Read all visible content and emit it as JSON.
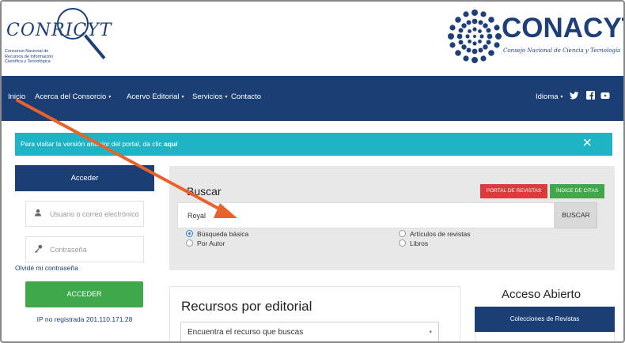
{
  "header": {
    "left_logo_word": "CONRICYT",
    "left_logo_sub": "Consorcio Nacional de Recursos de Información Científica y Tecnológica",
    "right_logo_brand": "CONACYT",
    "right_logo_tagline": "Consejo Nacional de Ciencia y Tecnología"
  },
  "nav": {
    "items": [
      {
        "label": "Inicio"
      },
      {
        "label": "Acerca del Consorcio",
        "caret": "▾"
      },
      {
        "label": "Acervo Editorial",
        "caret": "▾"
      },
      {
        "label": "Servicios",
        "caret": "▾"
      },
      {
        "label": "Contacto"
      }
    ],
    "idioma": "Idioma",
    "idioma_caret": "▾",
    "social": [
      "twitter-icon",
      "facebook-icon",
      "youtube-icon"
    ],
    "color": "#1b3f75"
  },
  "banner": {
    "text": "Para visitar la versión anterior del portal, da clic ",
    "link": "aquí",
    "close": "×",
    "color": "#1fb3c6"
  },
  "login": {
    "title": "Acceder",
    "user_placeholder": "Usuario o correo electrónico",
    "password_placeholder": "Contraseña",
    "forgot": "Olvidé mi contraseña",
    "button": "ACCEDER",
    "ip_text": "IP no registrada 201.110.171.28"
  },
  "search": {
    "title": "Buscar",
    "portal_button": "PORTAL DE REVISTAS",
    "citas_button": "ÍNDICE DE CITAS",
    "value": "Royal",
    "submit": "BUSCAR",
    "options": [
      {
        "label": "Búsqueda básica",
        "selected": true
      },
      {
        "label": "Por Autor",
        "selected": false
      },
      {
        "label": "Artículos de revistas",
        "selected": false
      },
      {
        "label": "Libros",
        "selected": false
      }
    ]
  },
  "recursos": {
    "title": "Recursos por editorial",
    "select_value": "Encuentra el recurso que buscas",
    "select_arrow": "▾"
  },
  "acceso": {
    "title": "Acceso Abierto",
    "colecciones": "Colecciones de Revistas"
  },
  "colors": {
    "green": "#3fa84a",
    "red": "#dd3b3b",
    "annotation_arrow": "#e8622a"
  }
}
